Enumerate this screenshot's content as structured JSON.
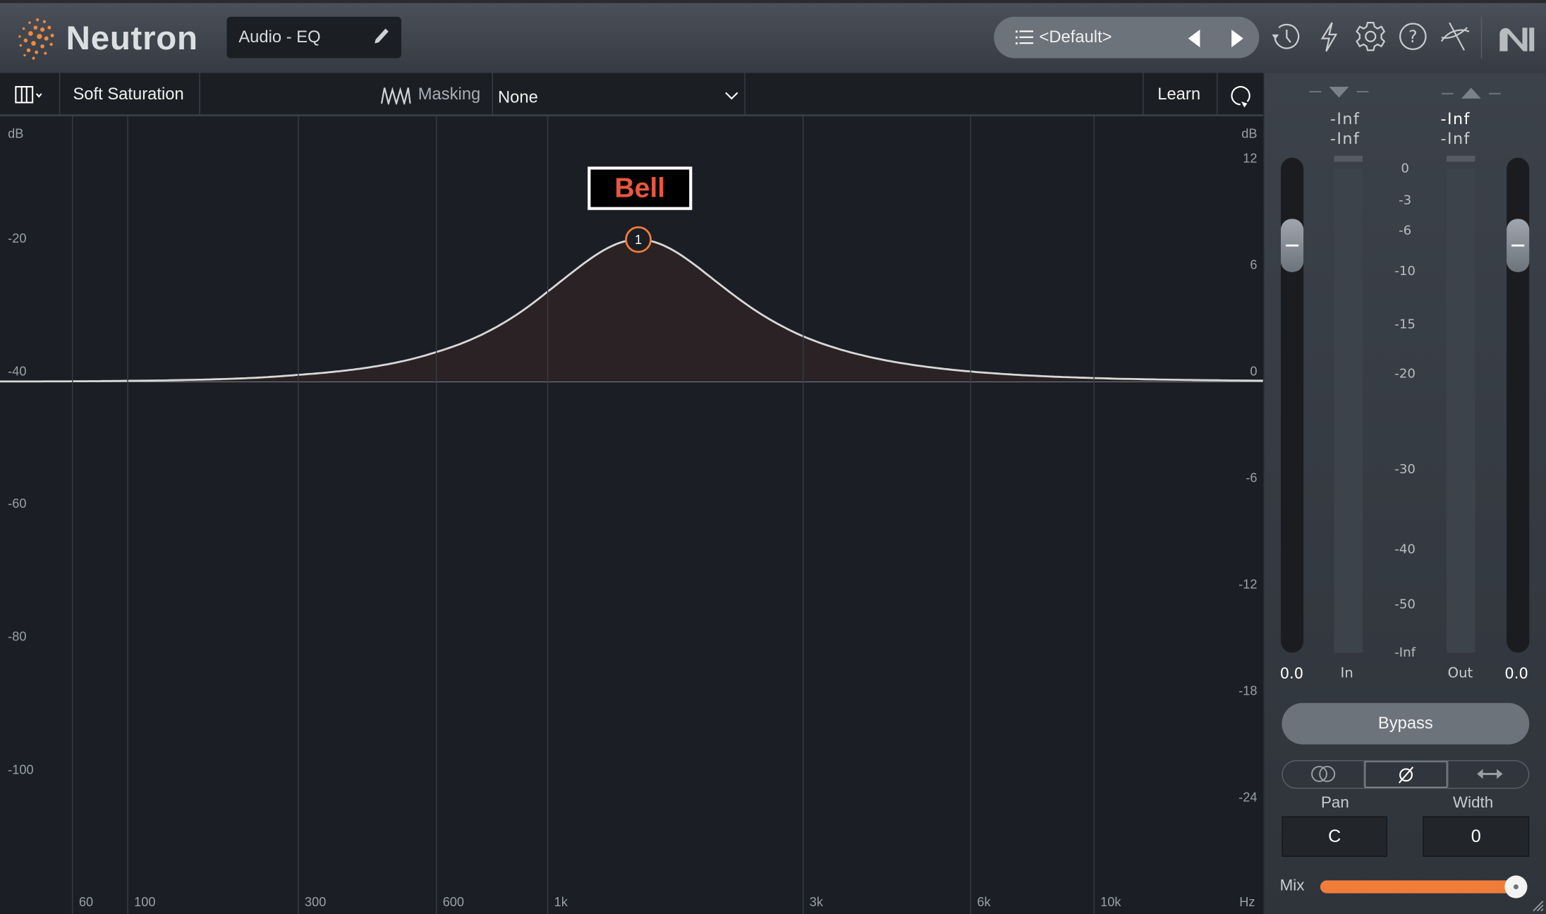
{
  "header": {
    "app_name": "Neutron",
    "module_name": "Audio - EQ",
    "preset": "<Default>",
    "icons": [
      "preset-list-icon",
      "previous-preset-icon",
      "next-preset-icon",
      "history-icon",
      "lightning-icon",
      "gear-icon",
      "help-icon",
      "routing-icon",
      "ni-logo"
    ]
  },
  "toolbar": {
    "mode": "Soft Saturation",
    "masking_label": "Masking",
    "masking_value": "None",
    "learn": "Learn"
  },
  "chart_data": {
    "type": "line",
    "title": "",
    "x_scale": "log",
    "x_unit": "Hz",
    "x_ticks": [
      {
        "value": 60,
        "label": "60"
      },
      {
        "value": 100,
        "label": "100"
      },
      {
        "value": 300,
        "label": "300"
      },
      {
        "value": 600,
        "label": "600"
      },
      {
        "value": 1000,
        "label": "1k"
      },
      {
        "value": 3000,
        "label": "3k"
      },
      {
        "value": 6000,
        "label": "6k"
      },
      {
        "value": 10000,
        "label": "10k"
      }
    ],
    "left_axis": {
      "unit": "dB",
      "ticks": [
        -20,
        -40,
        -60,
        -80,
        -100
      ]
    },
    "right_axis": {
      "unit": "dB",
      "ticks": [
        12,
        6,
        0,
        -6,
        -12,
        -18,
        -24
      ],
      "range": [
        -24,
        12
      ]
    },
    "grid": "vertical",
    "bands": [
      {
        "id": "1",
        "type": "Bell",
        "freq_hz": 1480,
        "gain_db": 8,
        "q": 0.95
      }
    ],
    "selected_band_label": "Bell"
  },
  "meters": {
    "in_peak": "-Inf",
    "in_rms": "-Inf",
    "out_peak": "-Inf",
    "out_rms": "-Inf",
    "scale": [
      "0",
      "-3",
      "-6",
      "-10",
      "-15",
      "-20",
      "-30",
      "-40",
      "-50",
      "-Inf"
    ],
    "in_label": "In",
    "out_label": "Out",
    "input_gain": "0.0",
    "output_gain": "0.0",
    "input_gain_db": 0,
    "output_gain_db": 0
  },
  "controls": {
    "bypass": "Bypass",
    "pan_label": "Pan",
    "pan_value": "C",
    "width_label": "Width",
    "width_value": "0",
    "mix_label": "Mix",
    "mix_percent": 100,
    "stereo_modes": [
      "link-icon",
      "phase-invert-icon",
      "swap-icon"
    ],
    "selected_mode": 1
  },
  "colors": {
    "accent": "#f07c3a",
    "bell_label": "#e8573f",
    "curve": "#d8d8d8",
    "background": "#1b1e24",
    "panel": "#343a42"
  }
}
